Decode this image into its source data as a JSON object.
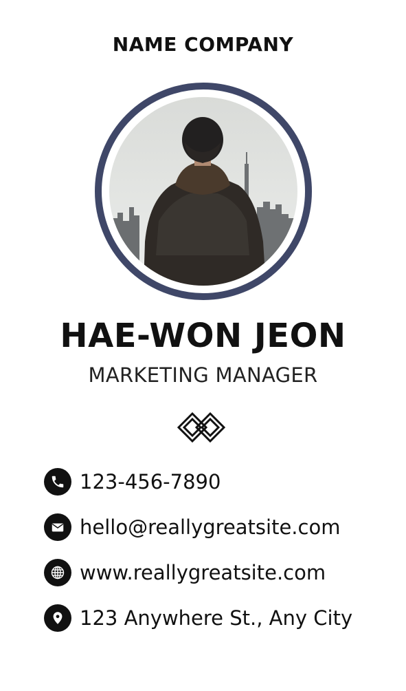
{
  "card": {
    "company": "NAME COMPANY",
    "name": "HAE-WON JEON",
    "title": "MARKETING MANAGER",
    "accent_color": "#3f4768"
  },
  "contacts": [
    {
      "icon": "phone-icon",
      "text": "123-456-7890"
    },
    {
      "icon": "email-icon",
      "text": "hello@reallygreatsite.com"
    },
    {
      "icon": "globe-icon",
      "text": "www.reallygreatsite.com"
    },
    {
      "icon": "location-pin-icon",
      "text": "123 Anywhere St., Any City"
    }
  ]
}
